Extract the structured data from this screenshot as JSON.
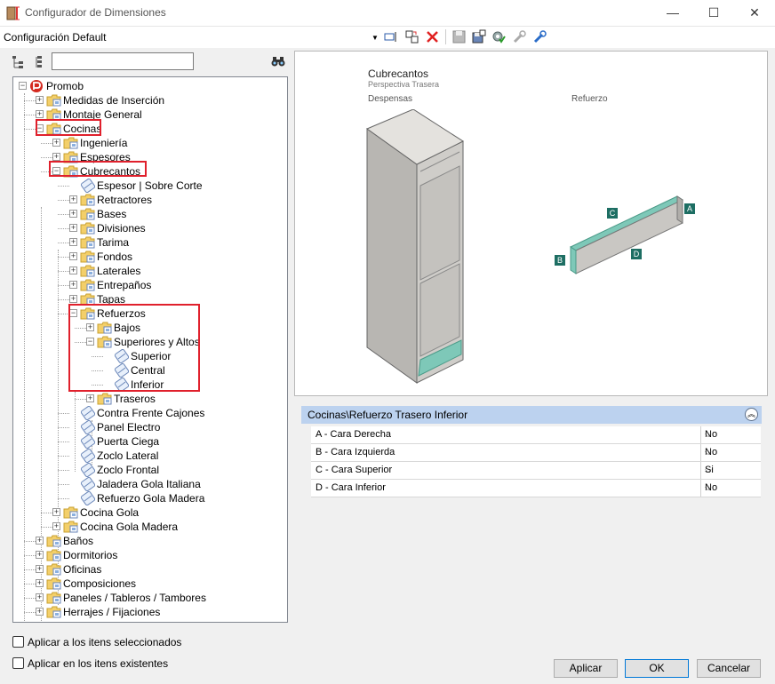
{
  "window": {
    "title": "Configurador de Dimensiones",
    "minimize": "—",
    "maximize": "☐",
    "close": "✕"
  },
  "toolbar": {
    "config_name": "Configuración Default"
  },
  "tree": {
    "root": "Promob",
    "items": [
      "Medidas de Inserción",
      "Montaje General",
      "Cocinas",
      "Ingeniería",
      "Espesores",
      "Cubrecantos",
      "Espesor | Sobre Corte",
      "Retractores",
      "Bases",
      "Divisiones",
      "Tarima",
      "Fondos",
      "Laterales",
      "Entrepaños",
      "Tapas",
      "Refuerzos",
      "Bajos",
      "Superiores y Altos",
      "Superior",
      "Central",
      "Inferior",
      "Traseros",
      "Contra Frente Cajones",
      "Panel Electro",
      "Puerta Ciega",
      "Zoclo Lateral",
      "Zoclo Frontal",
      "Jaladera Gola Italiana",
      "Refuerzo Gola Madera",
      "Cocina Gola",
      "Cocina Gola Madera",
      "Baños",
      "Dormitorios",
      "Oficinas",
      "Composiciones",
      "Paneles / Tableros / Tambores",
      "Herrajes / Fijaciones"
    ]
  },
  "preview": {
    "title": "Cubrecantos",
    "subtitle": "Perspectiva Trasera",
    "label_left": "Despensas",
    "label_right": "Refuerzo",
    "markers": {
      "a": "A",
      "b": "B",
      "c": "C",
      "d": "D"
    },
    "accent": "#7ec8b8"
  },
  "properties": {
    "header": "Cocinas\\Refuerzo Trasero Inferior",
    "rows": [
      {
        "name": "A - Cara Derecha",
        "value": "No"
      },
      {
        "name": "B - Cara Izquierda",
        "value": "No"
      },
      {
        "name": "C - Cara Superior",
        "value": "Si"
      },
      {
        "name": "D - Cara Inferior",
        "value": "No"
      }
    ]
  },
  "options": {
    "apply_selected": "Aplicar a los itens seleccionados",
    "apply_existing": "Aplicar en los itens existentes"
  },
  "buttons": {
    "apply": "Aplicar",
    "ok": "OK",
    "cancel": "Cancelar"
  }
}
